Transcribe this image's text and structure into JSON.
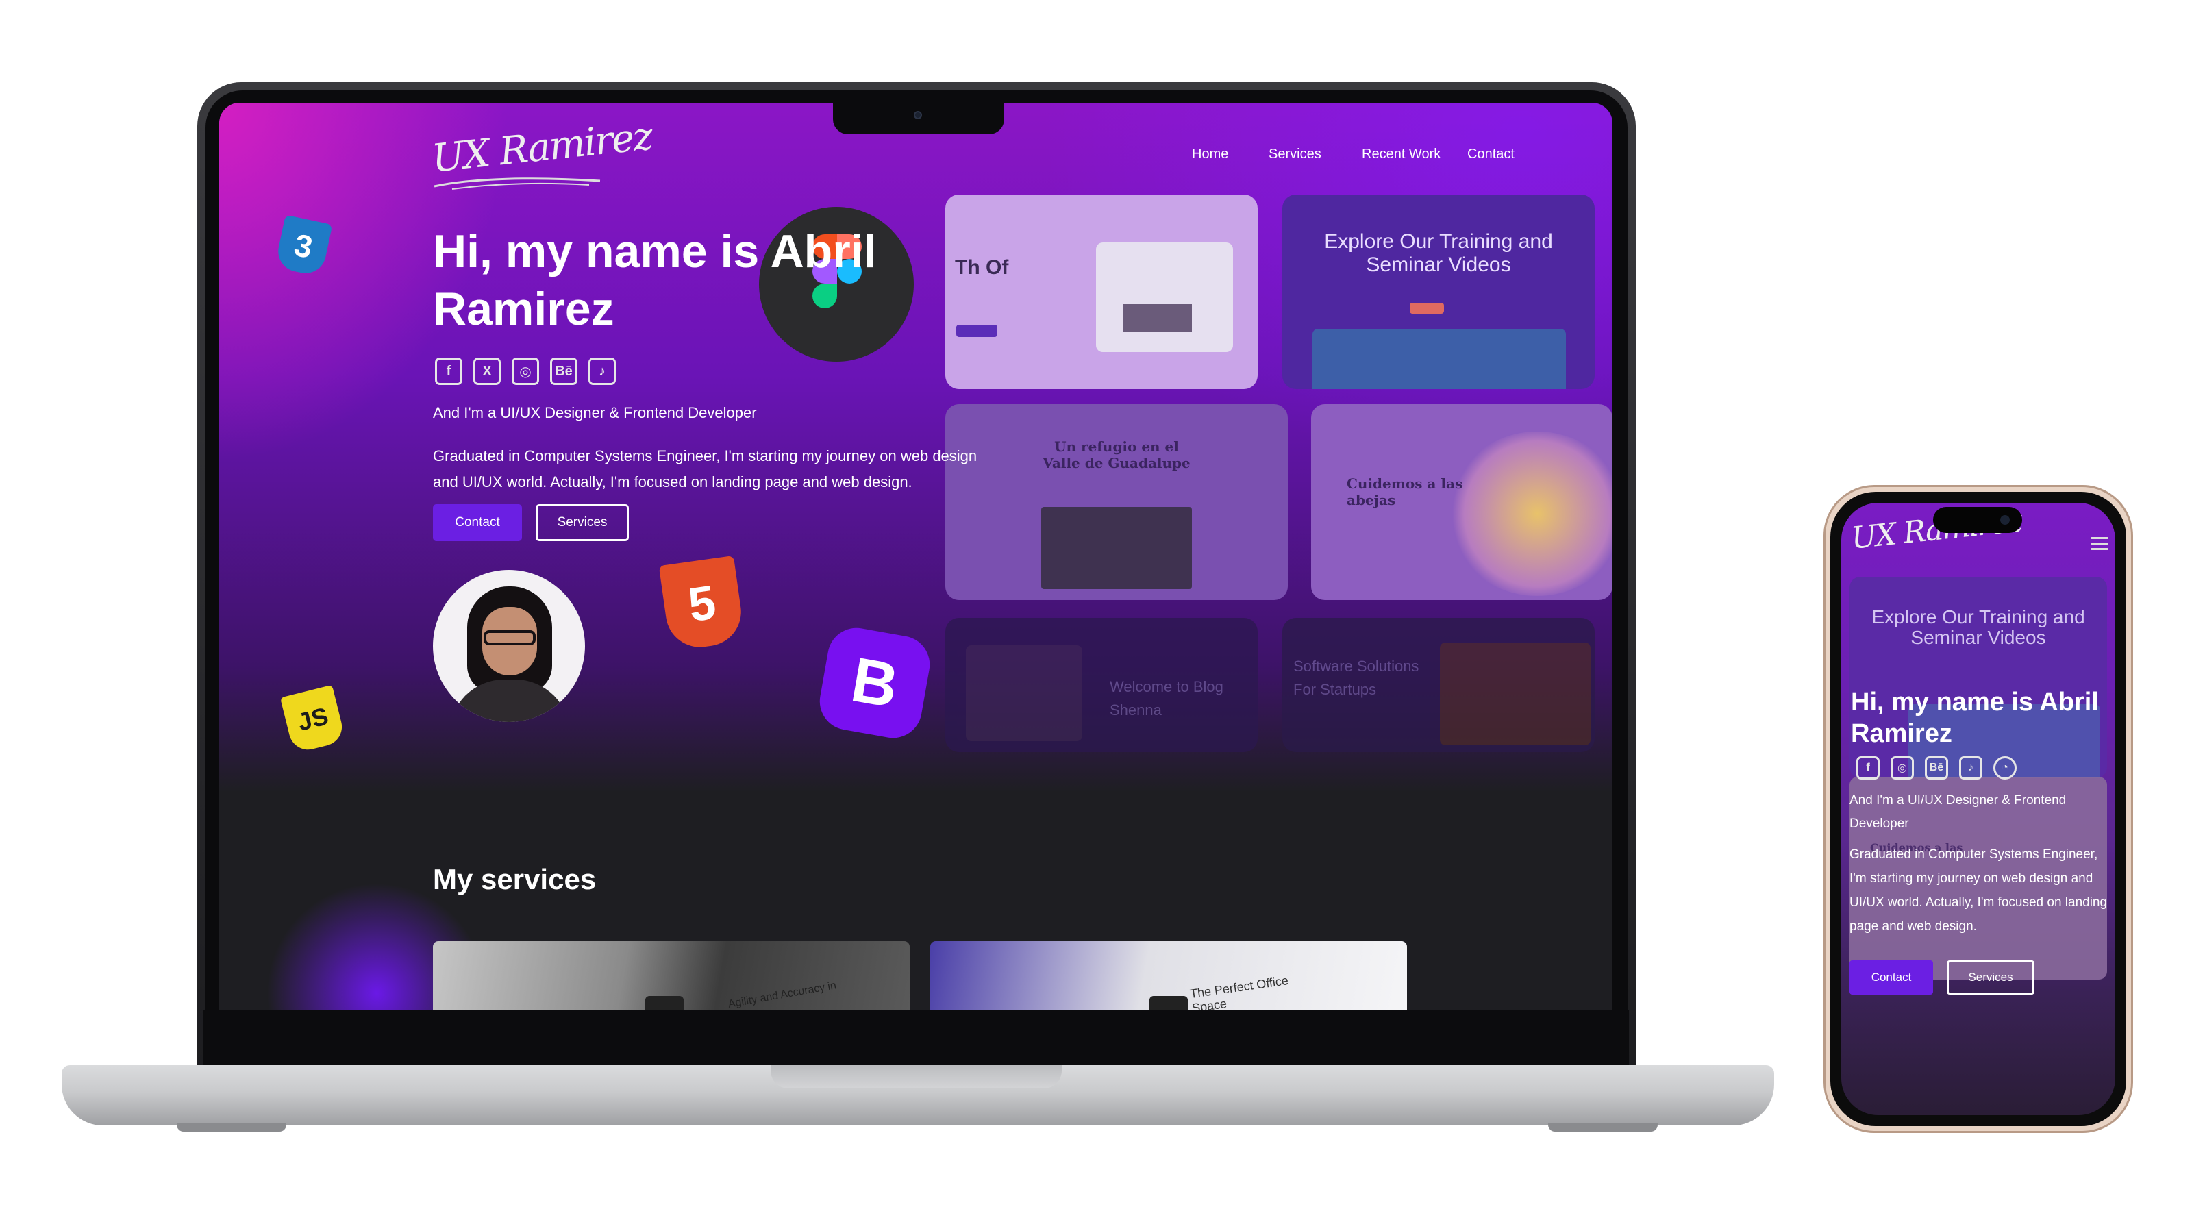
{
  "site": {
    "logo": "UX Ramirez",
    "nav": [
      "Home",
      "Services",
      "Recent Work",
      "Contact"
    ],
    "hero": {
      "title": "Hi, my name is Abril Ramirez",
      "subtitle": "And I'm a UI/UX Designer & Frontend Developer",
      "description": "Graduated in Computer Systems Engineer, I'm starting my journey on web design and UI/UX world. Actually, I'm focused on landing page and web design.",
      "contact_label": "Contact",
      "services_label": "Services"
    },
    "socials": [
      "facebook-icon",
      "x-twitter-icon",
      "instagram-icon",
      "behance-icon",
      "tiktok-icon"
    ],
    "services_heading": "My services"
  },
  "projects": [
    {
      "name": "project-thumb-1",
      "text": "Th Of"
    },
    {
      "name": "project-thumb-2",
      "text": "Explore Our Training and Seminar Videos"
    },
    {
      "name": "project-thumb-3",
      "text": "Un refugio en el Valle de Guadalupe"
    },
    {
      "name": "project-thumb-4",
      "text": "Cuidemos a las abejas"
    },
    {
      "name": "project-thumb-5",
      "text": "Welcome to Blog Shenna"
    },
    {
      "name": "project-thumb-6",
      "text": "Software Solutions For Startups"
    }
  ],
  "service_cards": [
    {
      "text": "Agility and Accuracy in"
    },
    {
      "text": "The Perfect Office Space"
    }
  ],
  "phone": {
    "logo": "UX Ramirez",
    "card_text": "Explore Our Training and Seminar Videos",
    "overlay_text": "Cuidemos a las",
    "title": "Hi, my name is Abril Ramirez",
    "subtitle": "And I'm a UI/UX Designer & Frontend Developer",
    "description": "Graduated in Computer Systems Engineer, I'm starting my journey on web design and UI/UX world. Actually, I'm focused on landing page and web design.",
    "contact_label": "Contact",
    "services_label": "Services",
    "socials": [
      "facebook-icon",
      "instagram-icon",
      "behance-icon",
      "tiktok-icon",
      "github-icon"
    ],
    "menu_icon": "hamburger-menu-icon"
  },
  "tech_badges": [
    "css3-icon",
    "javascript-icon",
    "html5-icon",
    "bootstrap-icon",
    "figma-icon"
  ],
  "colors": {
    "accent": "#6b1fe3",
    "gradient_top": "#8b16c6",
    "magenta": "#d41fc2",
    "dark_bg": "#1e1e22"
  }
}
